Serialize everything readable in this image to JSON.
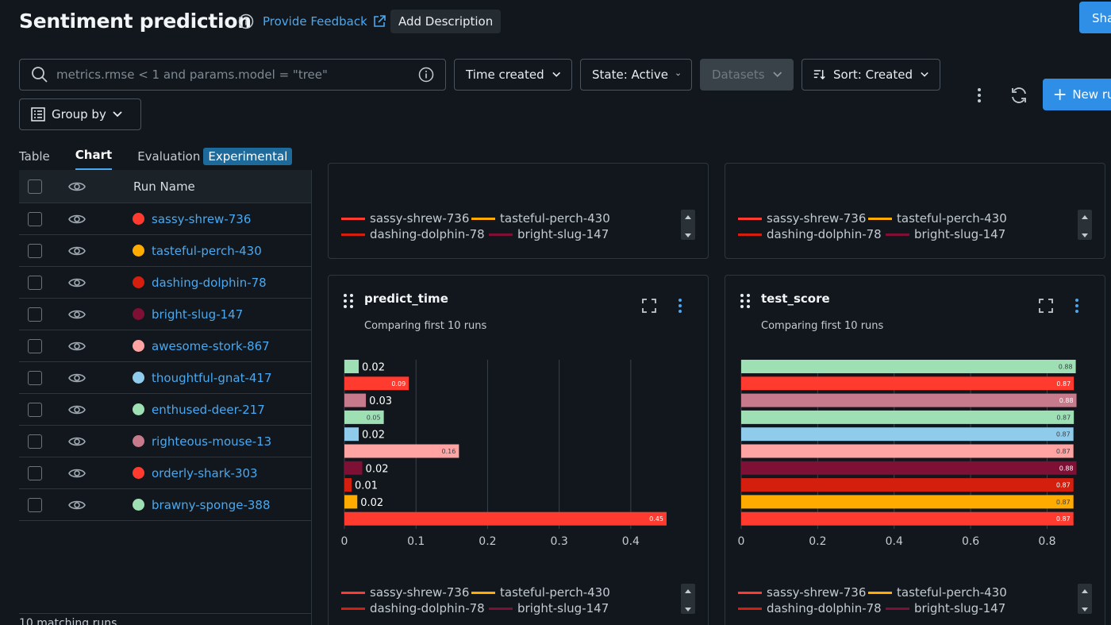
{
  "header": {
    "title": "Sentiment prediction",
    "feedback_label": "Provide Feedback",
    "add_description_label": "Add Description",
    "share_label": "Share",
    "new_run_label": "New run"
  },
  "search": {
    "placeholder": "metrics.rmse < 1 and params.model = \"tree\""
  },
  "filters": {
    "time_created": "Time created",
    "state": "State: Active",
    "datasets": "Datasets",
    "sort": "Sort: Created",
    "group_by": "Group by"
  },
  "tabs": {
    "table": "Table",
    "chart": "Chart",
    "evaluation": "Evaluation",
    "experimental": "Experimental"
  },
  "runs_table": {
    "header_name": "Run Name",
    "rows": [
      {
        "name": "sassy-shrew-736",
        "color": "#ff3b2f"
      },
      {
        "name": "tasteful-perch-430",
        "color": "#ffab00"
      },
      {
        "name": "dashing-dolphin-78",
        "color": "#d41f0e"
      },
      {
        "name": "bright-slug-147",
        "color": "#7d1034"
      },
      {
        "name": "awesome-stork-867",
        "color": "#ffa3a3"
      },
      {
        "name": "thoughtful-gnat-417",
        "color": "#8fcbeb"
      },
      {
        "name": "enthused-deer-217",
        "color": "#9ee0b4"
      },
      {
        "name": "righteous-mouse-13",
        "color": "#c77a8c"
      },
      {
        "name": "orderly-shark-303",
        "color": "#ff3b2f"
      },
      {
        "name": "brawny-sponge-388",
        "color": "#9ee0b4"
      }
    ],
    "footer": "10 matching runs"
  },
  "legend": [
    {
      "name": "sassy-shrew-736",
      "color": "#ff3b2f"
    },
    {
      "name": "tasteful-perch-430",
      "color": "#ffab00"
    },
    {
      "name": "dashing-dolphin-78",
      "color": "#d41f0e"
    },
    {
      "name": "bright-slug-147",
      "color": "#7d1034"
    }
  ],
  "cards": {
    "predict_time": {
      "title": "predict_time",
      "subtitle": "Comparing first 10 runs"
    },
    "test_score": {
      "title": "test_score",
      "subtitle": "Comparing first 10 runs"
    }
  },
  "chart_data": [
    {
      "type": "bar",
      "orientation": "horizontal",
      "title": "predict_time",
      "xlim": [
        0,
        0.47
      ],
      "xticks": [
        0,
        0.1,
        0.2,
        0.3,
        0.4
      ],
      "bars": [
        {
          "value": 0.02,
          "label": "0.02",
          "color": "#9ee0b4"
        },
        {
          "value": 0.09,
          "label": "0.09",
          "color": "#ff3b2f"
        },
        {
          "value": 0.03,
          "label": "0.03",
          "color": "#c77a8c"
        },
        {
          "value": 0.055,
          "label": "0.05",
          "color": "#9ee0b4"
        },
        {
          "value": 0.02,
          "label": "0.02",
          "color": "#8fcbeb"
        },
        {
          "value": 0.16,
          "label": "0.16",
          "color": "#ffa3a3"
        },
        {
          "value": 0.025,
          "label": "0.02",
          "color": "#7d1034"
        },
        {
          "value": 0.01,
          "label": "0.01",
          "color": "#d41f0e"
        },
        {
          "value": 0.018,
          "label": "0.02",
          "color": "#ffab00"
        },
        {
          "value": 0.45,
          "label": "0.45",
          "color": "#ff3b2f"
        }
      ]
    },
    {
      "type": "bar",
      "orientation": "horizontal",
      "title": "test_score",
      "xlim": [
        0,
        0.88
      ],
      "xticks": [
        0,
        0.2,
        0.4,
        0.6,
        0.8
      ],
      "bars": [
        {
          "value": 0.875,
          "label": "0.88",
          "color": "#9ee0b4"
        },
        {
          "value": 0.87,
          "label": "0.87",
          "color": "#ff3b2f"
        },
        {
          "value": 0.877,
          "label": "0.88",
          "color": "#c77a8c"
        },
        {
          "value": 0.87,
          "label": "0.87",
          "color": "#9ee0b4"
        },
        {
          "value": 0.869,
          "label": "0.87",
          "color": "#8fcbeb"
        },
        {
          "value": 0.869,
          "label": "0.87",
          "color": "#ffa3a3"
        },
        {
          "value": 0.877,
          "label": "0.88",
          "color": "#7d1034"
        },
        {
          "value": 0.869,
          "label": "0.87",
          "color": "#d41f0e"
        },
        {
          "value": 0.869,
          "label": "0.87",
          "color": "#ffab00"
        },
        {
          "value": 0.869,
          "label": "0.87",
          "color": "#ff3b2f"
        }
      ]
    }
  ]
}
